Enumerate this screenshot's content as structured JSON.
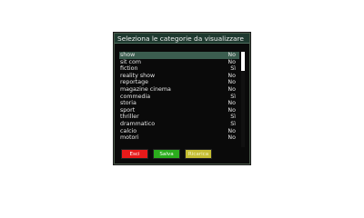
{
  "dialog": {
    "title": "Seleziona le categorie da visualizzare"
  },
  "categories": [
    {
      "label": "show",
      "value": "No",
      "selected": true
    },
    {
      "label": "sit com",
      "value": "No"
    },
    {
      "label": "fiction",
      "value": "Sì"
    },
    {
      "label": "reality show",
      "value": "No"
    },
    {
      "label": "reportage",
      "value": "No"
    },
    {
      "label": "magazine cinema",
      "value": "No"
    },
    {
      "label": "commedia",
      "value": "Sì"
    },
    {
      "label": "storia",
      "value": "No"
    },
    {
      "label": "sport",
      "value": "No"
    },
    {
      "label": "thriller",
      "value": "Sì"
    },
    {
      "label": "drammatico",
      "value": "Sì"
    },
    {
      "label": "calcio",
      "value": "No"
    },
    {
      "label": "motori",
      "value": "No"
    }
  ],
  "buttons": {
    "exit_label": "Esci",
    "save_label": "Salva",
    "reset_label": "Ricarica"
  },
  "colors": {
    "exit": "#e81a1a",
    "save": "#2bad1d",
    "reset": "#c4bd32",
    "selection": "#3b5d4f",
    "title_bar": "#1f3a30"
  }
}
